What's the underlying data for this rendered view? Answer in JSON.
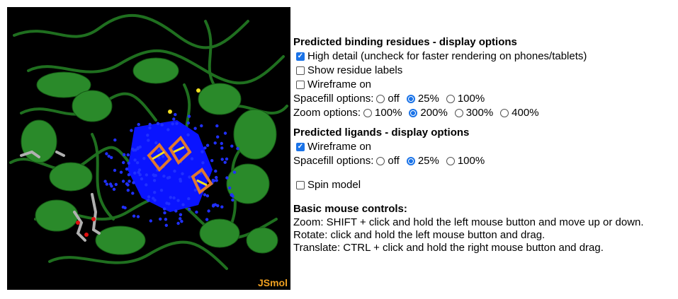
{
  "viewer": {
    "brand": "JSmol"
  },
  "binding": {
    "heading": "Predicted binding residues - display options",
    "high_detail": {
      "label": "High detail (uncheck for faster rendering on phones/tablets)",
      "checked": true
    },
    "residue_labels": {
      "label": "Show residue labels",
      "checked": false
    },
    "wireframe": {
      "label": "Wireframe on",
      "checked": false
    },
    "spacefill": {
      "label": "Spacefill options:",
      "options": [
        "off",
        "25%",
        "100%"
      ],
      "selected": "25%"
    },
    "zoom": {
      "label": "Zoom options:",
      "options": [
        "100%",
        "200%",
        "300%",
        "400%"
      ],
      "selected": "200%"
    }
  },
  "ligands": {
    "heading": "Predicted ligands - display options",
    "wireframe": {
      "label": "Wireframe on",
      "checked": true
    },
    "spacefill": {
      "label": "Spacefill options:",
      "options": [
        "off",
        "25%",
        "100%"
      ],
      "selected": "25%"
    }
  },
  "spin": {
    "label": "Spin model",
    "checked": false
  },
  "mouse": {
    "heading": "Basic mouse controls:",
    "lines": [
      "Zoom: SHIFT + click and hold the left mouse button and move up or down.",
      "Rotate: click and hold the left mouse button and drag.",
      "Translate: CTRL + click and hold the right mouse button and drag."
    ]
  },
  "colors": {
    "protein": "#1f7a1f",
    "binding_site": "#0a14ff",
    "ligand_orange": "#e07830",
    "ligand_yellow": "#f2e020",
    "brand": "#f0a020"
  }
}
